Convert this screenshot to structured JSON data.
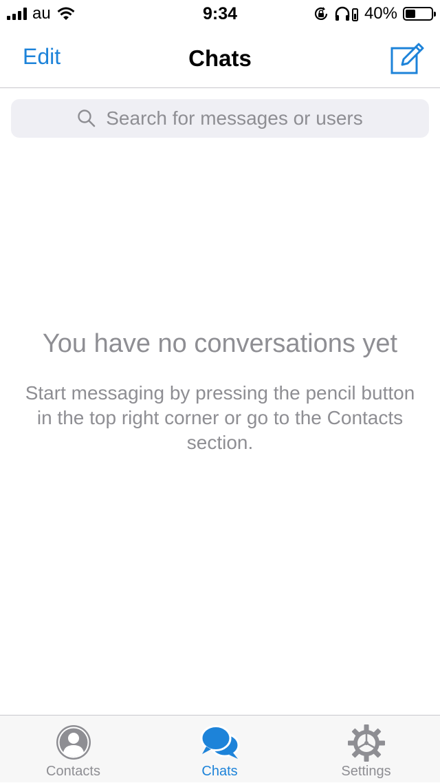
{
  "status_bar": {
    "carrier": "au",
    "time": "9:34",
    "battery_percent": "40%",
    "battery_level": 0.4,
    "icons": [
      "signal-icon",
      "wifi-icon",
      "rotation-lock-icon",
      "headphones-icon",
      "battery-icon"
    ]
  },
  "nav": {
    "edit_label": "Edit",
    "title": "Chats",
    "compose_icon": "compose-pencil-icon"
  },
  "search": {
    "placeholder": "Search for messages or users"
  },
  "empty_state": {
    "title": "You have no conversations yet",
    "body": "Start messaging by pressing the pencil button in the top right corner or go to the Contacts section."
  },
  "tabs": [
    {
      "label": "Contacts",
      "icon": "person-icon",
      "active": false
    },
    {
      "label": "Chats",
      "icon": "chat-bubbles-icon",
      "active": true
    },
    {
      "label": "Settings",
      "icon": "gear-icon",
      "active": false
    }
  ],
  "colors": {
    "accent": "#1d83d9",
    "secondary_text": "#8e8e93",
    "search_background": "#efeff4",
    "separator": "#c8c7cc"
  }
}
